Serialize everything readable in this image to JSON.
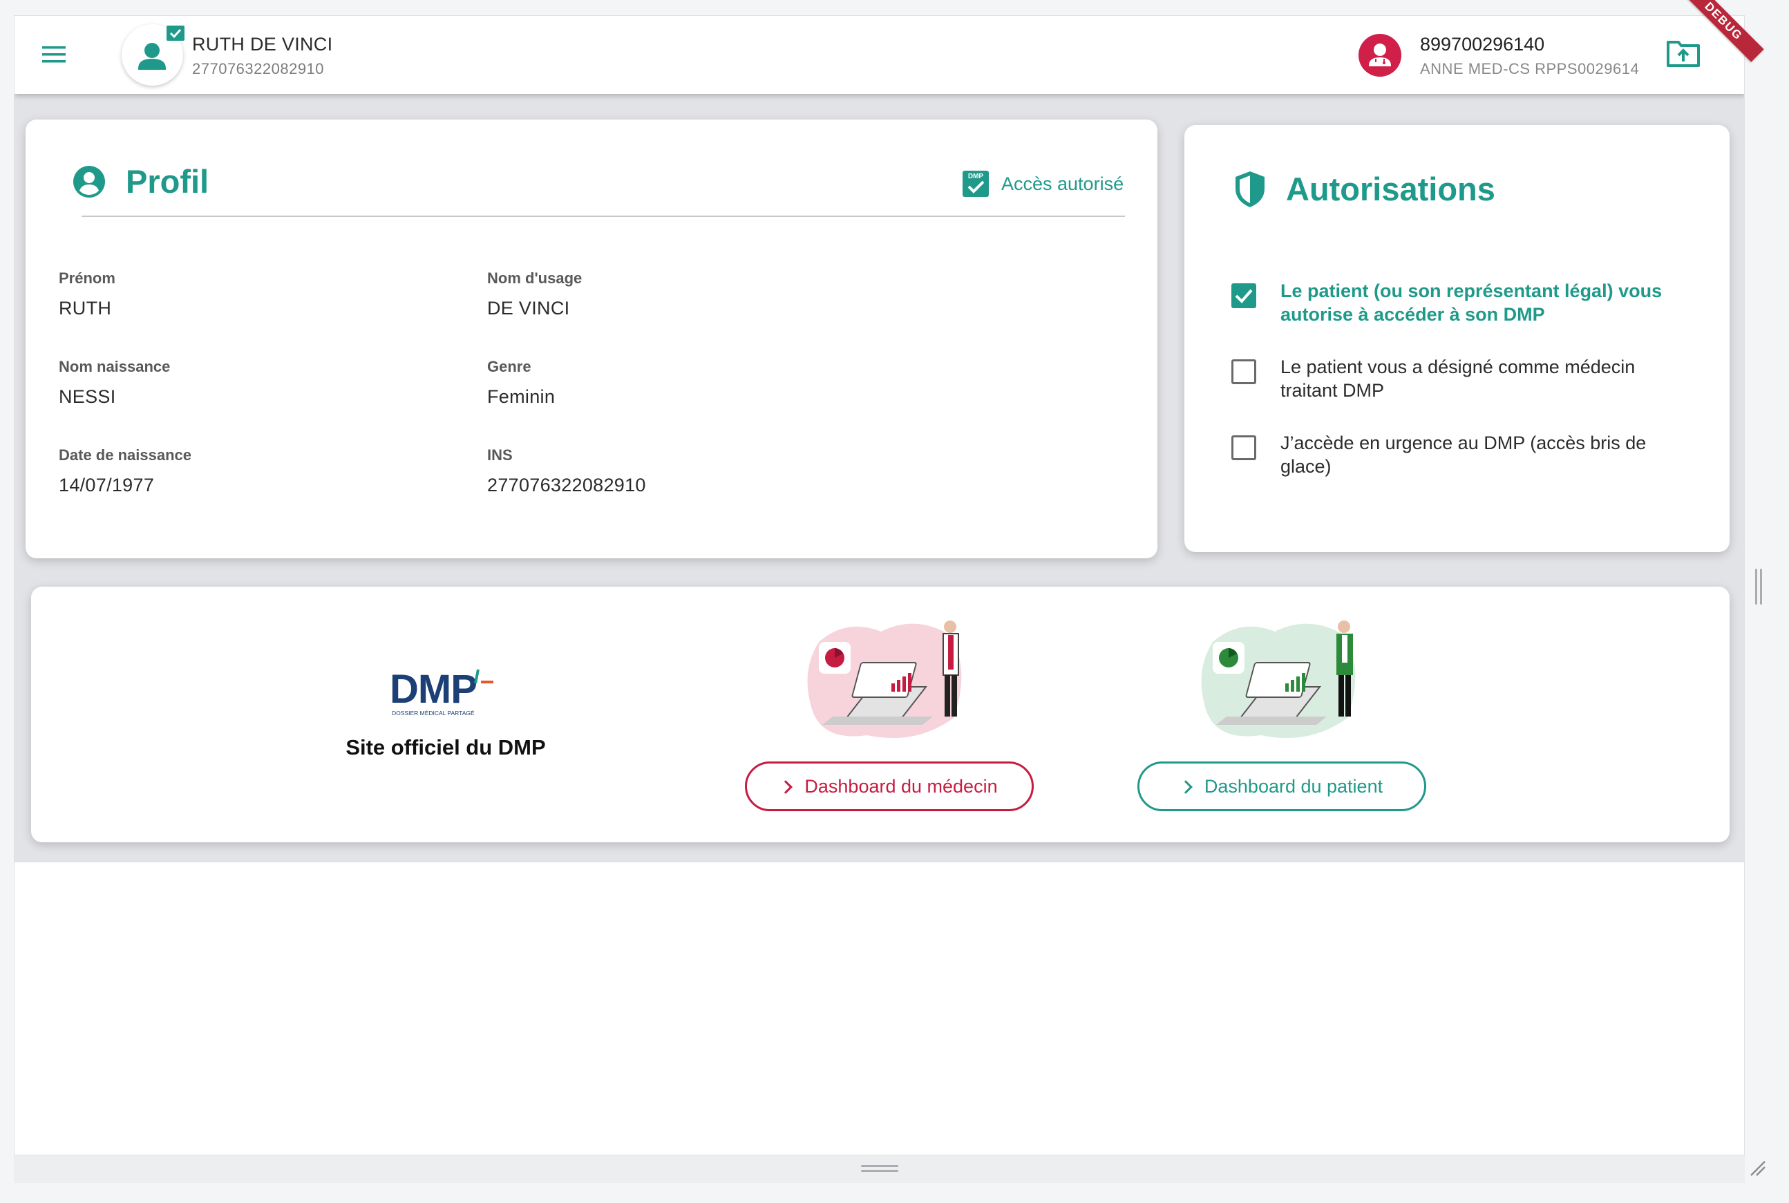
{
  "header": {
    "patient_name": "RUTH DE VINCI",
    "patient_ins": "277076322082910",
    "doctor_id": "899700296140",
    "doctor_name": "ANNE MED-CS RPPS0029614",
    "debug_banner": "DEBUG",
    "icons": [
      "menu-icon",
      "patient-avatar-icon",
      "dmp-check-badge-icon",
      "doctor-icon",
      "upload-folder-icon"
    ]
  },
  "profil": {
    "title": "Profil",
    "access_label": "Accès autorisé",
    "access_badge": "DMP",
    "fields": [
      {
        "label": "Prénom",
        "value": "RUTH"
      },
      {
        "label": "Nom d'usage",
        "value": "DE VINCI"
      },
      {
        "label": "Nom naissance",
        "value": "NESSI"
      },
      {
        "label": "Genre",
        "value": "Feminin"
      },
      {
        "label": "Date de naissance",
        "value": "14/07/1977"
      },
      {
        "label": "INS",
        "value": "277076322082910"
      }
    ]
  },
  "autorisations": {
    "title": "Autorisations",
    "items": [
      {
        "label": "Le patient (ou son représentant légal) vous autorise à accéder à son DMP",
        "checked": true
      },
      {
        "label": "Le patient vous a désigné comme médecin traitant DMP",
        "checked": false
      },
      {
        "label": "J’accède en urgence au DMP (accès bris de glace)",
        "checked": false
      }
    ]
  },
  "links": {
    "dmp_logo_text": "DMP",
    "dmp_logo_subtext": "DOSSIER MÉDICAL PARTAGÉ",
    "dmp_caption": "Site officiel du DMP",
    "doctor_button": "Dashboard du médecin",
    "patient_button": "Dashboard du patient"
  },
  "colors": {
    "primary": "#1f9a8a",
    "doctor_accent": "#c71c42",
    "doctor_icon_bg": "#d01f48",
    "debug_banner": "#b8283a",
    "background": "#e2e3e7"
  }
}
